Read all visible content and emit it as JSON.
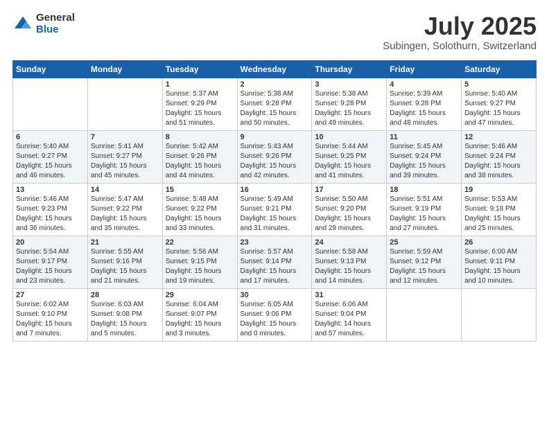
{
  "logo": {
    "general": "General",
    "blue": "Blue"
  },
  "title": "July 2025",
  "location": "Subingen, Solothurn, Switzerland",
  "weekdays": [
    "Sunday",
    "Monday",
    "Tuesday",
    "Wednesday",
    "Thursday",
    "Friday",
    "Saturday"
  ],
  "weeks": [
    [
      {
        "day": "",
        "info": ""
      },
      {
        "day": "",
        "info": ""
      },
      {
        "day": "1",
        "info": "Sunrise: 5:37 AM\nSunset: 9:29 PM\nDaylight: 15 hours and 51 minutes."
      },
      {
        "day": "2",
        "info": "Sunrise: 5:38 AM\nSunset: 9:28 PM\nDaylight: 15 hours and 50 minutes."
      },
      {
        "day": "3",
        "info": "Sunrise: 5:38 AM\nSunset: 9:28 PM\nDaylight: 15 hours and 49 minutes."
      },
      {
        "day": "4",
        "info": "Sunrise: 5:39 AM\nSunset: 9:28 PM\nDaylight: 15 hours and 48 minutes."
      },
      {
        "day": "5",
        "info": "Sunrise: 5:40 AM\nSunset: 9:27 PM\nDaylight: 15 hours and 47 minutes."
      }
    ],
    [
      {
        "day": "6",
        "info": "Sunrise: 5:40 AM\nSunset: 9:27 PM\nDaylight: 15 hours and 46 minutes."
      },
      {
        "day": "7",
        "info": "Sunrise: 5:41 AM\nSunset: 9:27 PM\nDaylight: 15 hours and 45 minutes."
      },
      {
        "day": "8",
        "info": "Sunrise: 5:42 AM\nSunset: 9:26 PM\nDaylight: 15 hours and 44 minutes."
      },
      {
        "day": "9",
        "info": "Sunrise: 5:43 AM\nSunset: 9:26 PM\nDaylight: 15 hours and 42 minutes."
      },
      {
        "day": "10",
        "info": "Sunrise: 5:44 AM\nSunset: 9:25 PM\nDaylight: 15 hours and 41 minutes."
      },
      {
        "day": "11",
        "info": "Sunrise: 5:45 AM\nSunset: 9:24 PM\nDaylight: 15 hours and 39 minutes."
      },
      {
        "day": "12",
        "info": "Sunrise: 5:46 AM\nSunset: 9:24 PM\nDaylight: 15 hours and 38 minutes."
      }
    ],
    [
      {
        "day": "13",
        "info": "Sunrise: 5:46 AM\nSunset: 9:23 PM\nDaylight: 15 hours and 36 minutes."
      },
      {
        "day": "14",
        "info": "Sunrise: 5:47 AM\nSunset: 9:22 PM\nDaylight: 15 hours and 35 minutes."
      },
      {
        "day": "15",
        "info": "Sunrise: 5:48 AM\nSunset: 9:22 PM\nDaylight: 15 hours and 33 minutes."
      },
      {
        "day": "16",
        "info": "Sunrise: 5:49 AM\nSunset: 9:21 PM\nDaylight: 15 hours and 31 minutes."
      },
      {
        "day": "17",
        "info": "Sunrise: 5:50 AM\nSunset: 9:20 PM\nDaylight: 15 hours and 29 minutes."
      },
      {
        "day": "18",
        "info": "Sunrise: 5:51 AM\nSunset: 9:19 PM\nDaylight: 15 hours and 27 minutes."
      },
      {
        "day": "19",
        "info": "Sunrise: 5:53 AM\nSunset: 9:18 PM\nDaylight: 15 hours and 25 minutes."
      }
    ],
    [
      {
        "day": "20",
        "info": "Sunrise: 5:54 AM\nSunset: 9:17 PM\nDaylight: 15 hours and 23 minutes."
      },
      {
        "day": "21",
        "info": "Sunrise: 5:55 AM\nSunset: 9:16 PM\nDaylight: 15 hours and 21 minutes."
      },
      {
        "day": "22",
        "info": "Sunrise: 5:56 AM\nSunset: 9:15 PM\nDaylight: 15 hours and 19 minutes."
      },
      {
        "day": "23",
        "info": "Sunrise: 5:57 AM\nSunset: 9:14 PM\nDaylight: 15 hours and 17 minutes."
      },
      {
        "day": "24",
        "info": "Sunrise: 5:58 AM\nSunset: 9:13 PM\nDaylight: 15 hours and 14 minutes."
      },
      {
        "day": "25",
        "info": "Sunrise: 5:59 AM\nSunset: 9:12 PM\nDaylight: 15 hours and 12 minutes."
      },
      {
        "day": "26",
        "info": "Sunrise: 6:00 AM\nSunset: 9:11 PM\nDaylight: 15 hours and 10 minutes."
      }
    ],
    [
      {
        "day": "27",
        "info": "Sunrise: 6:02 AM\nSunset: 9:10 PM\nDaylight: 15 hours and 7 minutes."
      },
      {
        "day": "28",
        "info": "Sunrise: 6:03 AM\nSunset: 9:08 PM\nDaylight: 15 hours and 5 minutes."
      },
      {
        "day": "29",
        "info": "Sunrise: 6:04 AM\nSunset: 9:07 PM\nDaylight: 15 hours and 3 minutes."
      },
      {
        "day": "30",
        "info": "Sunrise: 6:05 AM\nSunset: 9:06 PM\nDaylight: 15 hours and 0 minutes."
      },
      {
        "day": "31",
        "info": "Sunrise: 6:06 AM\nSunset: 9:04 PM\nDaylight: 14 hours and 57 minutes."
      },
      {
        "day": "",
        "info": ""
      },
      {
        "day": "",
        "info": ""
      }
    ]
  ]
}
